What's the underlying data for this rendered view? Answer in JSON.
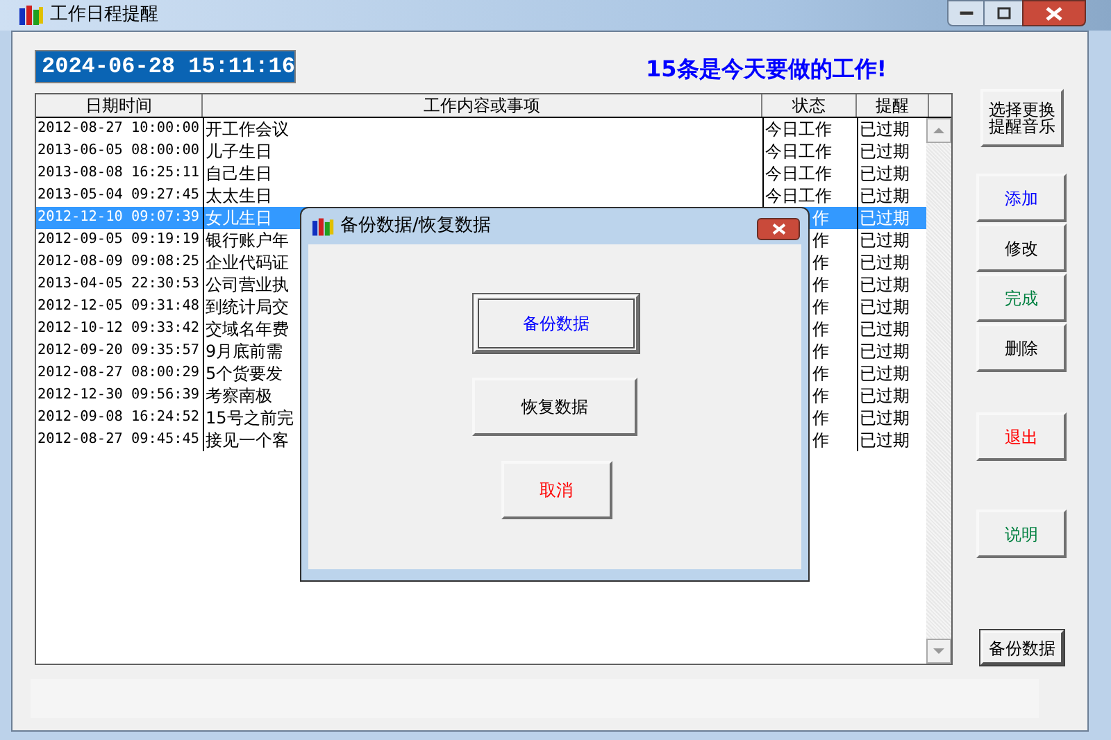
{
  "window": {
    "title": "工作日程提醒"
  },
  "clock": "2024-06-28 15:11:16",
  "headline": "15条是今天要做的工作!",
  "table": {
    "columns": [
      "日期时间",
      "工作内容或事项",
      "状态",
      "提醒"
    ],
    "rows": [
      {
        "cells": [
          "2012-08-27 10:00:00",
          "开工作会议",
          "今日工作",
          "已过期"
        ],
        "selected": false
      },
      {
        "cells": [
          "2013-06-05 08:00:00",
          "儿子生日",
          "今日工作",
          "已过期"
        ],
        "selected": false
      },
      {
        "cells": [
          "2013-08-08 16:25:11",
          "自己生日",
          "今日工作",
          "已过期"
        ],
        "selected": false
      },
      {
        "cells": [
          "2013-05-04 09:27:45",
          "太太生日",
          "今日工作",
          "已过期"
        ],
        "selected": false
      },
      {
        "cells": [
          "2012-12-10 09:07:39",
          "女儿生日",
          "作",
          "已过期"
        ],
        "selected": true
      },
      {
        "cells": [
          "2012-09-05 09:19:19",
          "银行账户年",
          "作",
          "已过期"
        ],
        "selected": false
      },
      {
        "cells": [
          "2012-08-09 09:08:25",
          "企业代码证",
          "作",
          "已过期"
        ],
        "selected": false
      },
      {
        "cells": [
          "2013-04-05 22:30:53",
          "公司营业执",
          "作",
          "已过期"
        ],
        "selected": false
      },
      {
        "cells": [
          "2012-12-05 09:31:48",
          "到统计局交",
          "作",
          "已过期"
        ],
        "selected": false
      },
      {
        "cells": [
          "2012-10-12 09:33:42",
          "交域名年费",
          "作",
          "已过期"
        ],
        "selected": false
      },
      {
        "cells": [
          "2012-09-20 09:35:57",
          "9月底前需",
          "作",
          "已过期"
        ],
        "selected": false
      },
      {
        "cells": [
          "2012-08-27 08:00:29",
          "5个货要发",
          "作",
          "已过期"
        ],
        "selected": false
      },
      {
        "cells": [
          "2012-12-30 09:56:39",
          "考察南极",
          "作",
          "已过期"
        ],
        "selected": false
      },
      {
        "cells": [
          "2012-09-08 16:24:52",
          "15号之前完",
          "作",
          "已过期"
        ],
        "selected": false
      },
      {
        "cells": [
          "2012-08-27 09:45:45",
          "接见一个客",
          "作",
          "已过期"
        ],
        "selected": false
      }
    ]
  },
  "right_buttons": [
    {
      "label": "选择更换提醒音乐",
      "color": "#000000",
      "kind": "music"
    },
    {
      "label": "添加",
      "color": "#0000ff",
      "kind": "stack"
    },
    {
      "label": "修改",
      "color": "#000000",
      "kind": "stack"
    },
    {
      "label": "完成",
      "color": "#008040",
      "kind": "stack"
    },
    {
      "label": "删除",
      "color": "#000000",
      "kind": "stack"
    },
    {
      "label": "退出",
      "color": "#ff0000",
      "kind": "exit"
    },
    {
      "label": "说明",
      "color": "#008040",
      "kind": "help"
    },
    {
      "label": "备份数据",
      "color": "#000000",
      "kind": "small"
    }
  ],
  "dialog": {
    "title": "备份数据/恢复数据",
    "buttons": [
      {
        "label": "备份数据",
        "color": "#0000ff",
        "focused": true
      },
      {
        "label": "恢复数据",
        "color": "#000000",
        "focused": false
      },
      {
        "label": "取消",
        "color": "#ff0000",
        "focused": false
      }
    ]
  }
}
